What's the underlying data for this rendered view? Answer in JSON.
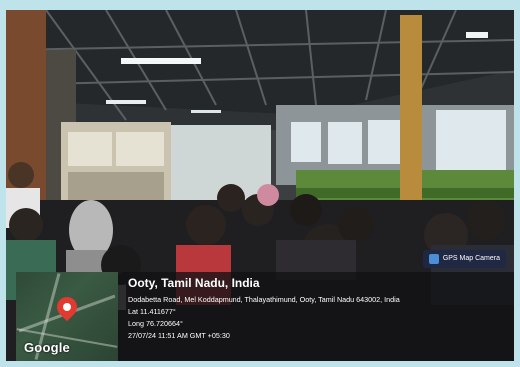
{
  "photo": {
    "description_icon": "photo-scene"
  },
  "map": {
    "logo_text": "Google",
    "pin_icon": "location-pin-icon"
  },
  "badge": {
    "label": "GPS Map Camera",
    "icon": "camera-icon"
  },
  "location": {
    "title": "Ooty, Tamil Nadu, India",
    "address": "Dodabetta Road, Mel Koddapmund, Thalayathimund, Ooty, Tamil Nadu 643002, India",
    "lat": "Lat 11.411677°",
    "long": "Long 76.720664°",
    "timestamp": "27/07/24 11:51 AM GMT +05:30"
  }
}
